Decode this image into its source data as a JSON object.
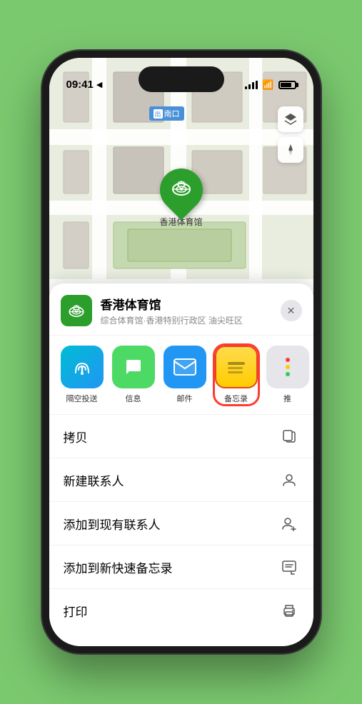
{
  "status_bar": {
    "time": "09:41",
    "location_arrow": "▶"
  },
  "map": {
    "label": "南口",
    "label_prefix": "出"
  },
  "map_controls": {
    "layers_icon": "🗺",
    "location_icon": "⬆"
  },
  "pin": {
    "label": "香港体育馆",
    "icon": "🏟"
  },
  "sheet": {
    "title": "香港体育馆",
    "subtitle": "综合体育馆·香港特别行政区 油尖旺区",
    "close_label": "✕"
  },
  "share_items": [
    {
      "id": "airdrop",
      "label": "隔空投送",
      "icon": "📶",
      "type": "airdrop"
    },
    {
      "id": "message",
      "label": "信息",
      "icon": "💬",
      "type": "message"
    },
    {
      "id": "mail",
      "label": "邮件",
      "icon": "✉",
      "type": "mail"
    },
    {
      "id": "notes",
      "label": "备忘录",
      "type": "notes"
    },
    {
      "id": "more",
      "label": "推",
      "type": "more"
    }
  ],
  "actions": [
    {
      "id": "copy",
      "label": "拷贝",
      "icon": "copy"
    },
    {
      "id": "new-contact",
      "label": "新建联系人",
      "icon": "person"
    },
    {
      "id": "add-existing",
      "label": "添加到现有联系人",
      "icon": "person-add"
    },
    {
      "id": "add-notes",
      "label": "添加到新快速备忘录",
      "icon": "quicknote"
    },
    {
      "id": "print",
      "label": "打印",
      "icon": "print"
    }
  ],
  "more_dots_colors": [
    "#ff3b30",
    "#ffcc00",
    "#34c759"
  ]
}
